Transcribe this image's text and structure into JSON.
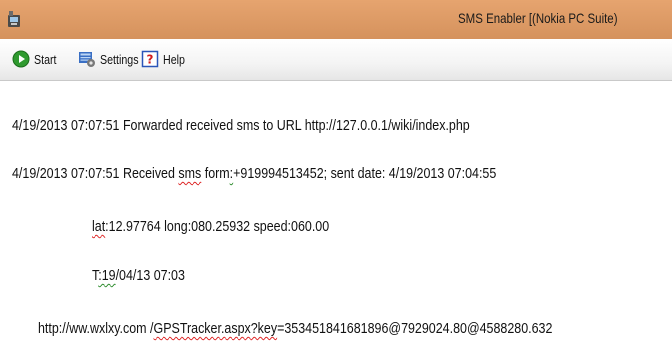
{
  "window": {
    "title": "SMS Enabler [(Nokia PC Suite)"
  },
  "toolbar": {
    "start_label": "Start",
    "settings_label": "Settings",
    "help_label": "Help"
  },
  "log": {
    "l1": "4/19/2013 07:07:51 Forwarded received sms to URL http://127.0.0.1/wiki/index.php",
    "l2a": "4/19/2013 07:07:51 Received ",
    "l2b": "sms",
    "l2c": " form",
    "l2d": ":",
    "l2e": "+919994513452; sent date: 4/19/2013 07:04:55",
    "l3a": "lat",
    "l3b": ":12.97764 long:080.25932 speed:060.00",
    "l4a": "T",
    "l4b": ":19",
    "l4c": "/04/13 07:03",
    "l5a": "http://ww.wxlxy.com /",
    "l5b": "GPSTracker.aspx?key",
    "l5c": "=353451841681896@7929024.80@4588280.632"
  },
  "colors": {
    "titlebar": "#d5925d",
    "spell_green": "#2a8a2a",
    "spell_red": "#d22"
  }
}
